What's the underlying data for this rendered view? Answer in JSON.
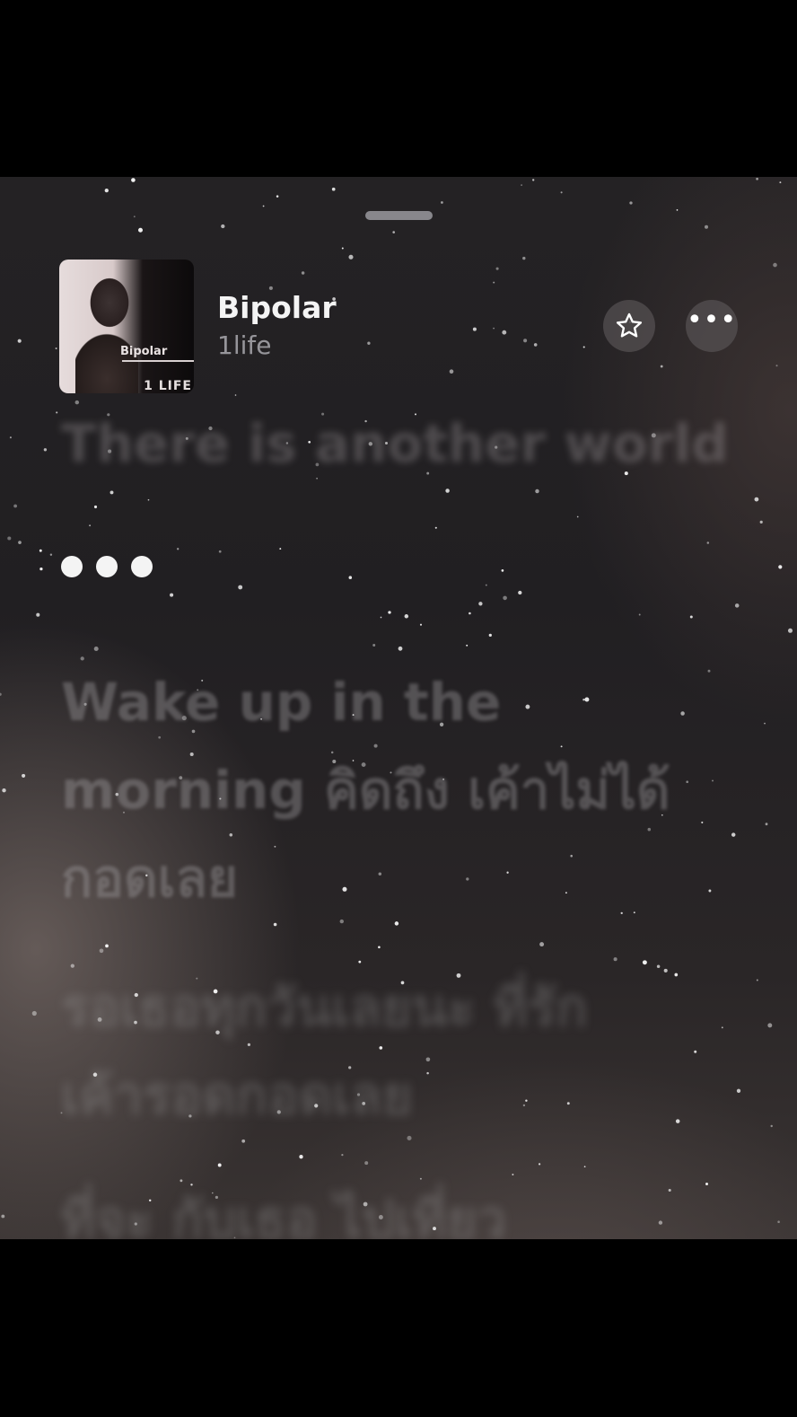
{
  "now_playing": {
    "title": "Bipolar",
    "artist": "1life",
    "artwork": {
      "title_text": "Bipolar",
      "subtitle_text": "1 LIFE"
    }
  },
  "actions": {
    "favorite_icon": "star-icon",
    "more_icon": "ellipsis-icon",
    "more_glyph": "•••"
  },
  "lyrics": {
    "previous_line": "There is another world",
    "waiting_indicator": "three-dots",
    "upcoming": [
      "Wake up in the",
      "morning คิดถึง เค้าไม่ได้",
      "กอดเลย",
      "รอเธอทุกวันเลยนะ ที่รัก",
      "เค้ารอดกอดเลย",
      "ที่จะ กับเธอ ไปเที่ยว"
    ]
  },
  "colors": {
    "background": "#221f22",
    "text_primary": "#f4f4f4",
    "text_secondary": "#8f8c90",
    "button_bg": "#5a5658"
  }
}
